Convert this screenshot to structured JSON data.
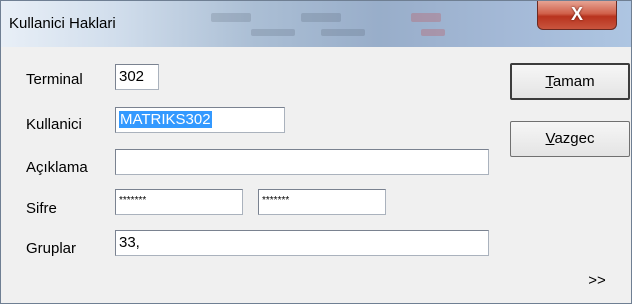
{
  "window": {
    "title": "Kullanici Haklari",
    "close_label": "X"
  },
  "form": {
    "terminal": {
      "label": "Terminal",
      "value": "302"
    },
    "kullanici": {
      "label": "Kullanici",
      "value": "MATRIKS302"
    },
    "aciklama": {
      "label": "Açıklama",
      "value": ""
    },
    "sifre": {
      "label": "Sifre",
      "value": "*******",
      "confirm_value": "*******"
    },
    "gruplar": {
      "label": "Gruplar",
      "value": "33,"
    }
  },
  "buttons": {
    "ok": {
      "mnemonic": "T",
      "rest": "amam"
    },
    "cancel": {
      "mnemonic": "V",
      "rest": "azgec"
    },
    "more_label": ">>"
  }
}
